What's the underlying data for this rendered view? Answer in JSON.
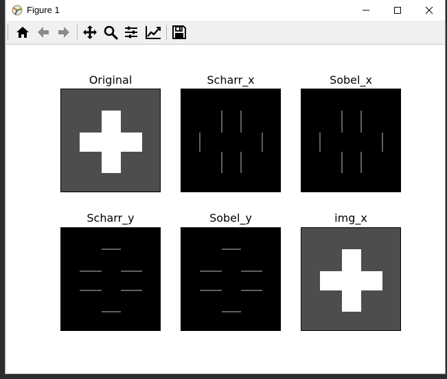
{
  "window": {
    "title": "Figure 1",
    "icon": "matplotlib-icon",
    "controls": [
      "minimize-icon",
      "maximize-icon",
      "close-icon"
    ]
  },
  "toolbar": {
    "tools": [
      {
        "name": "home-icon",
        "label": "Home"
      },
      {
        "name": "back-icon",
        "label": "Back"
      },
      {
        "name": "forward-icon",
        "label": "Forward"
      },
      {
        "name": "pan-icon",
        "label": "Pan"
      },
      {
        "name": "zoom-icon",
        "label": "Zoom"
      },
      {
        "name": "configure-subplots-icon",
        "label": "Subplots"
      },
      {
        "name": "edit-axis-icon",
        "label": "Customize"
      },
      {
        "name": "save-icon",
        "label": "Save"
      }
    ]
  },
  "subplots": [
    {
      "title": "Original",
      "kind": "cross-filled",
      "background": "#4d4d4d"
    },
    {
      "title": "Scharr_x",
      "kind": "edges-x",
      "background": "#000000"
    },
    {
      "title": "Sobel_x",
      "kind": "edges-x",
      "background": "#000000"
    },
    {
      "title": "Scharr_y",
      "kind": "edges-y",
      "background": "#000000"
    },
    {
      "title": "Sobel_y",
      "kind": "edges-y",
      "background": "#000000"
    },
    {
      "title": "img_x",
      "kind": "cross-filled",
      "background": "#4d4d4d"
    }
  ],
  "colors": {
    "cross_fill": "#ffffff",
    "edge_line": "#bfbfbf",
    "toolbar_bg": "#f0f0f0"
  }
}
